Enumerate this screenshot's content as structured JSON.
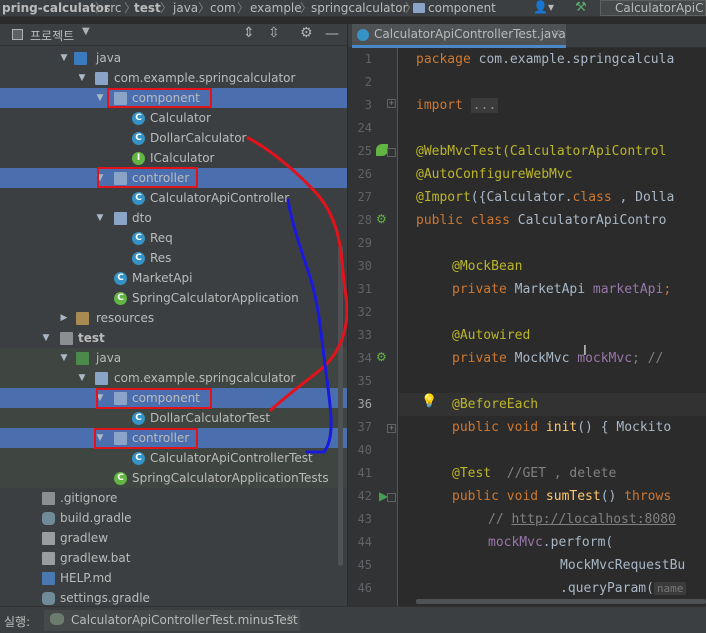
{
  "breadcrumb": {
    "items": [
      "pring-calculator",
      "src",
      "test",
      "java",
      "com",
      "example",
      "springcalculator",
      "component"
    ],
    "run_config": "CalculatorApiC"
  },
  "project_panel": {
    "title": "프로젝트"
  },
  "tree": [
    {
      "label": "java",
      "icon": "source-folder-icon"
    },
    {
      "label": "com.example.springcalculator",
      "icon": "package-icon"
    },
    {
      "label": "component",
      "icon": "package-icon"
    },
    {
      "label": "Calculator",
      "icon": "class-icon"
    },
    {
      "label": "DollarCalculator",
      "icon": "class-icon"
    },
    {
      "label": "ICalculator",
      "icon": "interface-icon"
    },
    {
      "label": "controller",
      "icon": "package-icon"
    },
    {
      "label": "CalculatorApiController",
      "icon": "class-icon"
    },
    {
      "label": "dto",
      "icon": "package-icon"
    },
    {
      "label": "Req",
      "icon": "class-icon"
    },
    {
      "label": "Res",
      "icon": "class-icon"
    },
    {
      "label": "MarketApi",
      "icon": "class-icon"
    },
    {
      "label": "SpringCalculatorApplication",
      "icon": "spring-class-icon"
    },
    {
      "label": "resources",
      "icon": "resources-folder-icon"
    },
    {
      "label": "test",
      "icon": "folder-icon"
    },
    {
      "label": "java",
      "icon": "test-source-folder-icon"
    },
    {
      "label": "com.example.springcalculator",
      "icon": "package-icon"
    },
    {
      "label": "component",
      "icon": "package-icon"
    },
    {
      "label": "DollarCalculatorTest",
      "icon": "test-class-icon"
    },
    {
      "label": "controller",
      "icon": "package-icon"
    },
    {
      "label": "CalculatorApiControllerTest",
      "icon": "test-class-icon"
    },
    {
      "label": "SpringCalculatorApplicationTests",
      "icon": "spring-test-class-icon"
    },
    {
      "label": ".gitignore",
      "icon": "gitignore-icon"
    },
    {
      "label": "build.gradle",
      "icon": "gradle-icon"
    },
    {
      "label": "gradlew",
      "icon": "file-icon"
    },
    {
      "label": "gradlew.bat",
      "icon": "file-icon"
    },
    {
      "label": "HELP.md",
      "icon": "markdown-icon"
    },
    {
      "label": "settings.gradle",
      "icon": "gradle-icon"
    }
  ],
  "editor": {
    "tab_label": "CalculatorApiControllerTest.java",
    "line_numbers": [
      "1",
      "2",
      "3",
      "24",
      "25",
      "26",
      "27",
      "28",
      "29",
      "30",
      "31",
      "32",
      "33",
      "34",
      "35",
      "36",
      "37",
      "40",
      "41",
      "42",
      "43",
      "44",
      "45",
      "46"
    ],
    "current_line": "36"
  },
  "code": {
    "l1_kw": "package",
    "l1_rest": " com.example.springcalcula",
    "l3_kw": "import",
    "l3_fold": "...",
    "l25": "@WebMvcTest(CalculatorApiControl",
    "l26": "@AutoConfigureWebMvc",
    "l27_an": "@Import",
    "l27_a": "({Calculator.",
    "l27_kw": "class",
    "l27_b": " , Dolla",
    "l28_kw": "public class",
    "l28_rest": " CalculatorApiContro",
    "l30": "@MockBean",
    "l31_kw": "private",
    "l31_type": " MarketApi ",
    "l31_fld": "marketApi",
    "l31_end": ";",
    "l33": "@Autowired",
    "l34_kw": "private",
    "l34_type": " MockMvc ",
    "l34_fld": "mockMvc",
    "l34_end": "; // ",
    "l36": "@BeforeEach",
    "l37_kw": "public void",
    "l37_fn": " init",
    "l37_rest": "() { Mockito",
    "l41_an": "@Test",
    "l41_cm": "  //GET , delete",
    "l42_kw": "public void",
    "l42_fn": " sumTest",
    "l42_rest": "() ",
    "l42_kw2": "throws",
    "l43_cm": "// ",
    "l43_url": "http://localhost:8080",
    "l44_fld": "mockMvc",
    "l44_rest": ".perform(",
    "l45": "MockMvcRequestBu",
    "l46_a": ".queryParam(",
    "l46_hint": "name"
  },
  "status": {
    "run_label": "실행:",
    "run_config": "CalculatorApiControllerTest.minusTest"
  },
  "colors": {
    "selection": "#4b6eaf",
    "annotation_box": "#e3121b",
    "red_arrow": "#e3121b",
    "blue_arrow": "#1a1adc"
  }
}
